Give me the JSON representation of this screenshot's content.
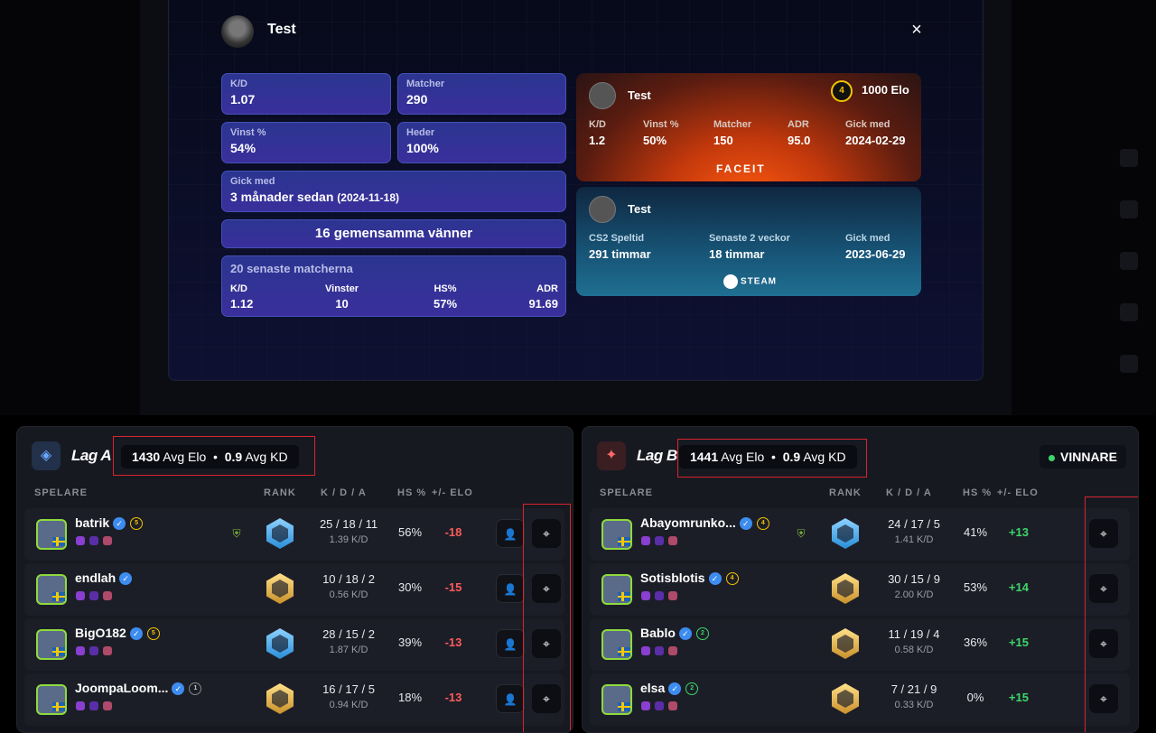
{
  "modal": {
    "title": "Test",
    "close_icon": "×",
    "stats": {
      "kd": {
        "label": "K/D",
        "value": "1.07"
      },
      "matches": {
        "label": "Matcher",
        "value": "290"
      },
      "win_pct": {
        "label": "Vinst %",
        "value": "54%"
      },
      "honor": {
        "label": "Heder",
        "value": "100%"
      },
      "joined": {
        "label": "Gick med",
        "value": "3 månader sedan",
        "date": "(2024-11-18)"
      }
    },
    "friends_button": "16 gemensamma vänner",
    "recent": {
      "title": "20 senaste matcherna",
      "cols": [
        {
          "label": "K/D",
          "value": "1.12"
        },
        {
          "label": "Vinster",
          "value": "10"
        },
        {
          "label": "HS%",
          "value": "57%"
        },
        {
          "label": "ADR",
          "value": "91.69"
        }
      ]
    },
    "faceit": {
      "name": "Test",
      "level": "4",
      "elo": "1000 Elo",
      "cols": [
        {
          "label": "K/D",
          "value": "1.2"
        },
        {
          "label": "Vinst %",
          "value": "50%"
        },
        {
          "label": "Matcher",
          "value": "150"
        },
        {
          "label": "ADR",
          "value": "95.0"
        },
        {
          "label": "Gick med",
          "value": "2024-02-29"
        }
      ],
      "logo": "FACEIT"
    },
    "steam": {
      "name": "Test",
      "cols": [
        {
          "label": "CS2 Speltid",
          "value": "291 timmar"
        },
        {
          "label": "Senaste 2 veckor",
          "value": "18 timmar"
        },
        {
          "label": "Gick med",
          "value": "2023-06-29"
        }
      ],
      "logo": "STEAM"
    }
  },
  "columns": {
    "player": "SPELARE",
    "rank": "RANK",
    "kda": "K / D / A",
    "hs": "HS %",
    "elo": "+/- ELO"
  },
  "team_a": {
    "name": "Lag A",
    "avg_elo": "1430",
    "avg_elo_label": "Avg Elo",
    "avg_kd": "0.9",
    "avg_kd_label": "Avg KD",
    "players": [
      {
        "name": "batrik",
        "level": "5",
        "rank": "blue",
        "k": "25",
        "d": "18",
        "a": "11",
        "kd": "1.39 K/D",
        "hs": "56%",
        "elo": "-18"
      },
      {
        "name": "endlah",
        "level": "",
        "rank": "gold",
        "k": "10",
        "d": "18",
        "a": "2",
        "kd": "0.56 K/D",
        "hs": "30%",
        "elo": "-15"
      },
      {
        "name": "BigO182",
        "level": "5",
        "rank": "blue",
        "k": "28",
        "d": "15",
        "a": "2",
        "kd": "1.87 K/D",
        "hs": "39%",
        "elo": "-13"
      },
      {
        "name": "JoompaLoom...",
        "level": "1",
        "rank": "gold",
        "k": "16",
        "d": "17",
        "a": "5",
        "kd": "0.94 K/D",
        "hs": "18%",
        "elo": "-13"
      }
    ]
  },
  "team_b": {
    "name": "Lag B",
    "avg_elo": "1441",
    "avg_elo_label": "Avg Elo",
    "avg_kd": "0.9",
    "avg_kd_label": "Avg KD",
    "winner": "VINNARE",
    "players": [
      {
        "name": "Abayomrunko...",
        "level": "4",
        "rank": "blue",
        "k": "24",
        "d": "17",
        "a": "5",
        "kd": "1.41 K/D",
        "hs": "41%",
        "elo": "+13"
      },
      {
        "name": "Sotisblotis",
        "level": "4",
        "rank": "gold",
        "k": "30",
        "d": "15",
        "a": "9",
        "kd": "2.00 K/D",
        "hs": "53%",
        "elo": "+14"
      },
      {
        "name": "Bablo",
        "level": "2",
        "rank": "gold",
        "k": "11",
        "d": "19",
        "a": "4",
        "kd": "0.58 K/D",
        "hs": "36%",
        "elo": "+15"
      },
      {
        "name": "elsa",
        "level": "2",
        "rank": "gold",
        "k": "7",
        "d": "21",
        "a": "9",
        "kd": "0.33 K/D",
        "hs": "0%",
        "elo": "+15"
      }
    ]
  },
  "colors": {
    "accent_blue": "#2b3590",
    "win_green": "#3dd66a",
    "loss_red": "#ff5b5b",
    "highlight_red": "#d9232e"
  }
}
